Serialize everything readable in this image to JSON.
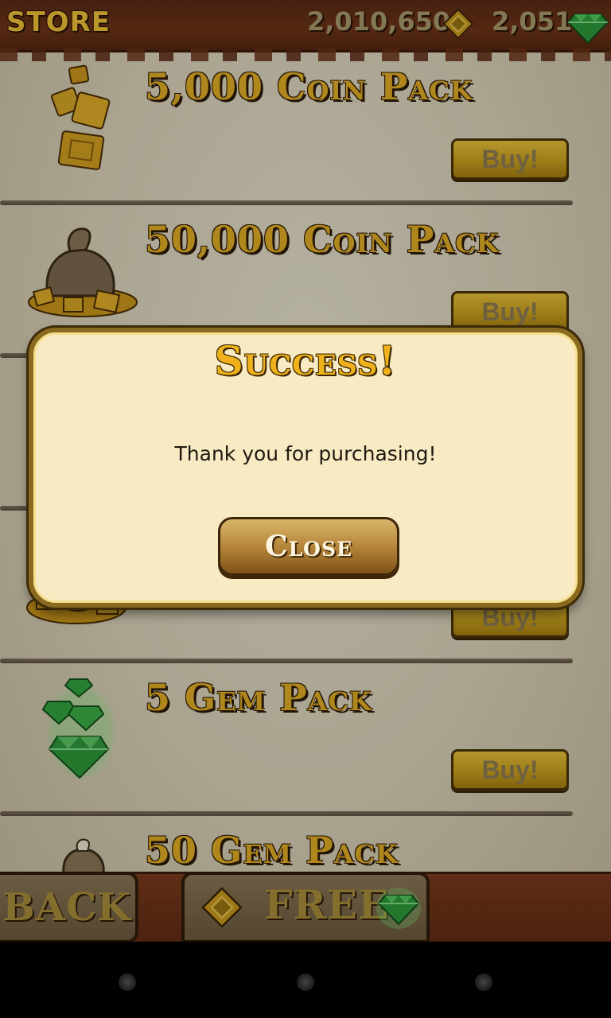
{
  "header": {
    "title": "STORE",
    "coins": "2,010,650",
    "gems": "2,051"
  },
  "store": {
    "items": [
      {
        "title": "5,000 Coin Pack",
        "button": "Buy!",
        "icon": "coin-stack-icon"
      },
      {
        "title": "50,000 Coin Pack",
        "button": "Buy!",
        "icon": "coin-bag-icon"
      },
      {
        "title": "",
        "button": "Buy!",
        "icon": "coin-pile-icon"
      },
      {
        "title": "5 Gem Pack",
        "button": "Buy!",
        "icon": "gem-cluster-icon"
      },
      {
        "title": "50 Gem Pack",
        "button": "",
        "icon": "gem-bag-icon"
      }
    ]
  },
  "dialog": {
    "title": "Success!",
    "message": "Thank you for purchasing!",
    "close_label": "Close"
  },
  "bottom": {
    "back_label": "BACK",
    "free_label": "FREE"
  },
  "colors": {
    "gold": "#e2ad25",
    "leather": "#622c14",
    "parchment": "#e9e3cf",
    "dialog_bg": "#f8eac2",
    "gem_green": "#3fb34a"
  }
}
